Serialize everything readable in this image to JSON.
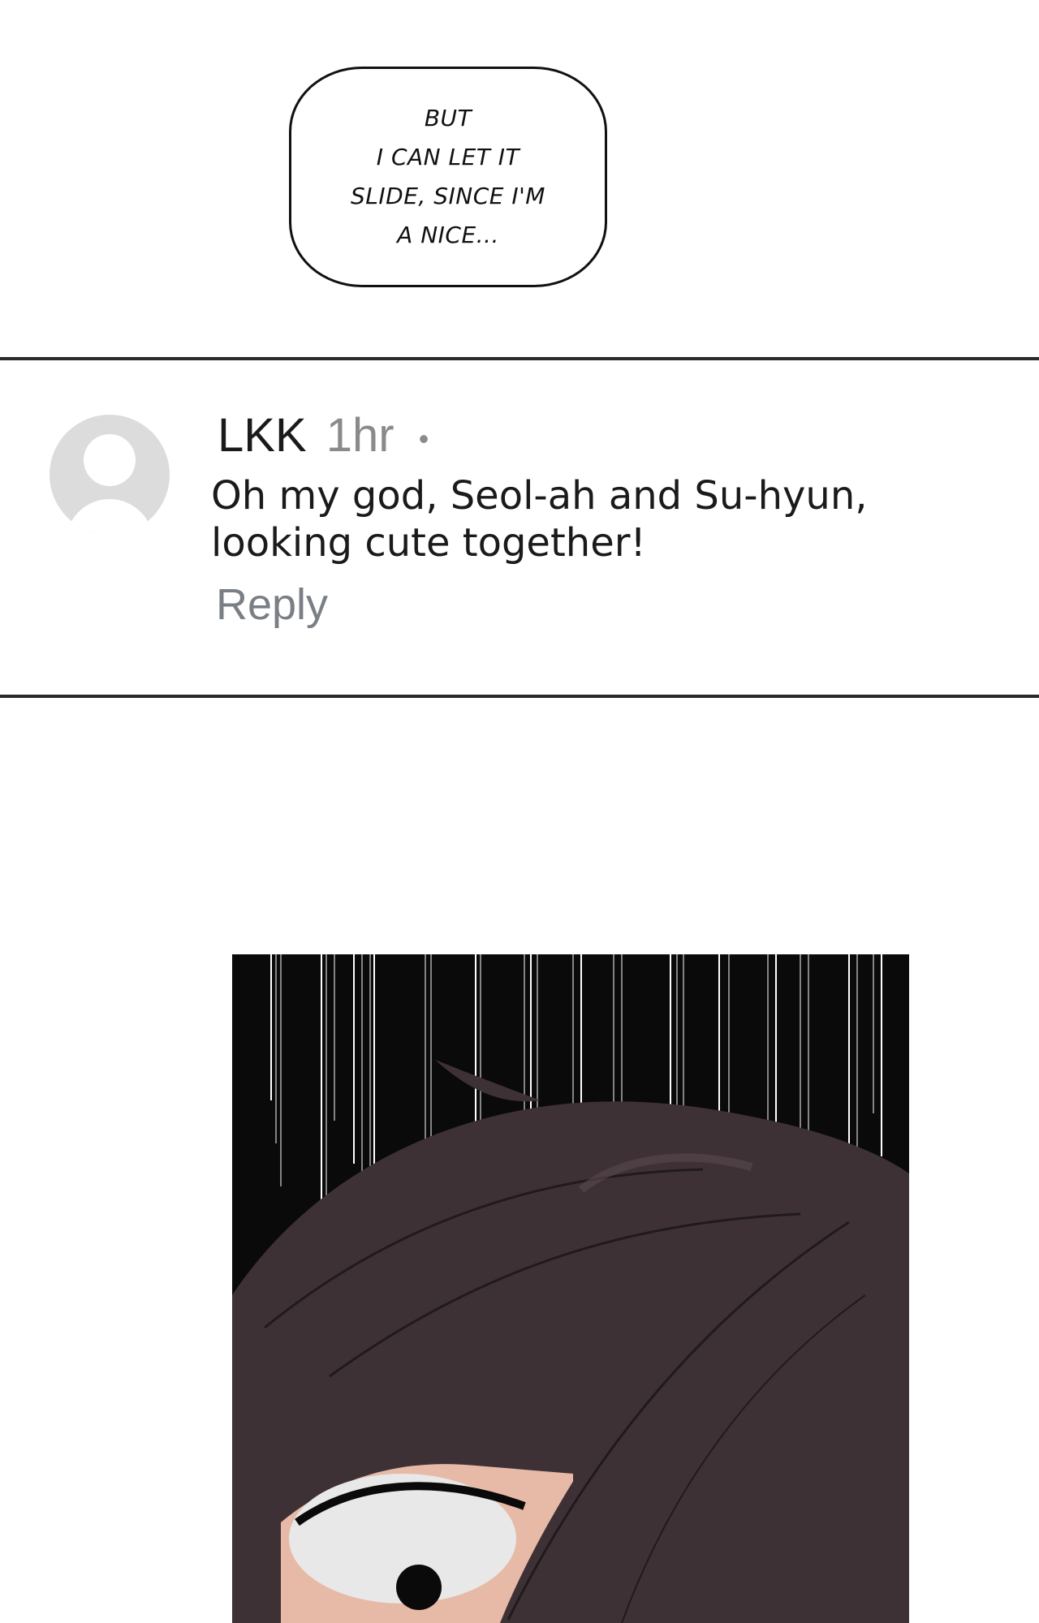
{
  "speech_bubble": {
    "lines": [
      "BUT",
      "I CAN LET IT",
      "SLIDE, SINCE I'M",
      "A NICE..."
    ]
  },
  "comment": {
    "username": "LKK",
    "time": "1hr",
    "separator": "•",
    "text_lines": [
      "Oh my god, Seol-ah and Su-hyun,",
      "looking cute together!"
    ],
    "reply_label": "Reply"
  },
  "colors": {
    "hair": "#3e3136",
    "hair_dark": "#2a2026",
    "skin": "#e7b9a7",
    "panel_bg": "#0a0a0a",
    "reply": "#7a7f86",
    "time": "#8a8a8a"
  }
}
